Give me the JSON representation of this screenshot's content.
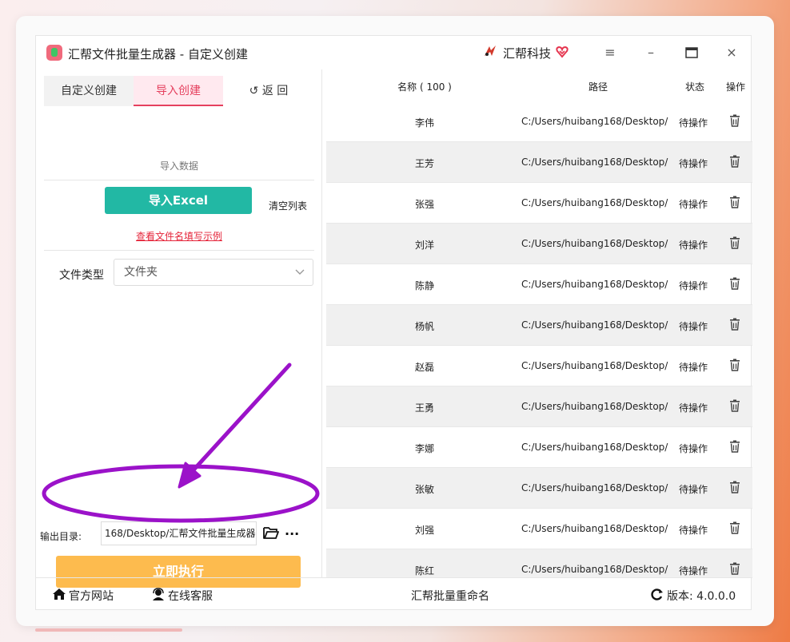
{
  "window": {
    "title": "汇帮文件批量生成器 - 自定义创建",
    "brand": "汇帮科技",
    "icons": [
      "brand-logo-icon",
      "heart-badge-icon",
      "hamburger-menu-icon",
      "minimize-icon",
      "maximize-icon",
      "close-icon"
    ]
  },
  "left": {
    "tabs": [
      "自定义创建",
      "导入创建",
      "↺ 返  回"
    ],
    "section_label": "导入数据",
    "import_button": "导入Excel",
    "clear_list": "清空列表",
    "example_link": "查看文件名填写示例",
    "file_type_label": "文件类型",
    "file_type_value": "文件夹",
    "output_label": "输出目录:",
    "output_value": "168/Desktop/汇帮文件批量生成器",
    "more": "···",
    "run_button": "立即执行"
  },
  "table": {
    "headers": [
      "名称 ( 100 )",
      "路径",
      "状态",
      "操作"
    ],
    "rows": [
      {
        "name": "李伟",
        "path": "C:/Users/huibang168/Desktop/",
        "status": "待操作"
      },
      {
        "name": "王芳",
        "path": "C:/Users/huibang168/Desktop/",
        "status": "待操作"
      },
      {
        "name": "张强",
        "path": "C:/Users/huibang168/Desktop/",
        "status": "待操作"
      },
      {
        "name": "刘洋",
        "path": "C:/Users/huibang168/Desktop/",
        "status": "待操作"
      },
      {
        "name": "陈静",
        "path": "C:/Users/huibang168/Desktop/",
        "status": "待操作"
      },
      {
        "name": "杨帆",
        "path": "C:/Users/huibang168/Desktop/",
        "status": "待操作"
      },
      {
        "name": "赵磊",
        "path": "C:/Users/huibang168/Desktop/",
        "status": "待操作"
      },
      {
        "name": "王勇",
        "path": "C:/Users/huibang168/Desktop/",
        "status": "待操作"
      },
      {
        "name": "李娜",
        "path": "C:/Users/huibang168/Desktop/",
        "status": "待操作"
      },
      {
        "name": "张敏",
        "path": "C:/Users/huibang168/Desktop/",
        "status": "待操作"
      },
      {
        "name": "刘强",
        "path": "C:/Users/huibang168/Desktop/",
        "status": "待操作"
      },
      {
        "name": "陈红",
        "path": "C:/Users/huibang168/Desktop/",
        "status": "待操作"
      }
    ]
  },
  "footer": {
    "website": "官方网站",
    "support": "在线客服",
    "center": "汇帮批量重命名",
    "version": "版本:  4.0.0.0"
  },
  "colors": {
    "accent_pink": "#e5405e",
    "import_teal": "#22b8a4",
    "run_orange": "#fdbb4e",
    "annotation_purple": "#9b12c9"
  }
}
